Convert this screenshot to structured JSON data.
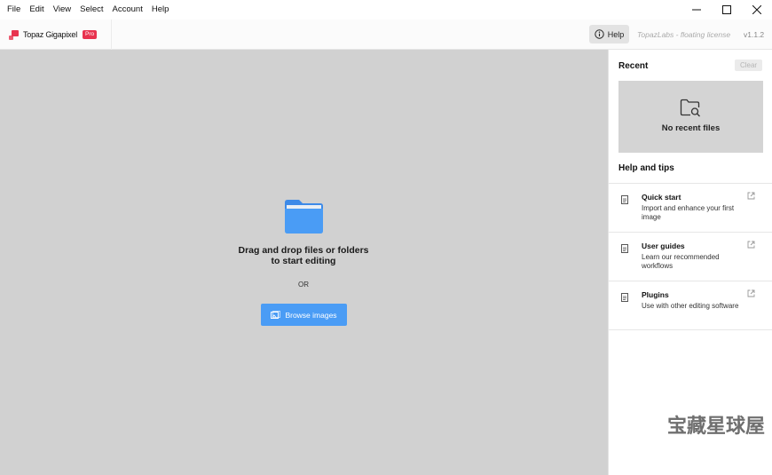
{
  "menu": [
    "File",
    "Edit",
    "View",
    "Select",
    "Account",
    "Help"
  ],
  "header": {
    "app_name": "Topaz Gigapixel",
    "badge": "Pro",
    "help_label": "Help",
    "license": "TopazLabs - floating license",
    "version": "v1.1.2"
  },
  "main": {
    "drop_line1": "Drag and drop files or folders",
    "drop_line2": "to start editing",
    "or": "OR",
    "browse_label": "Browse images"
  },
  "sidebar": {
    "recent_title": "Recent",
    "clear_label": "Clear",
    "no_recent": "No recent files",
    "help_title": "Help and tips",
    "tips": [
      {
        "title": "Quick start",
        "desc": "Import and enhance your first image"
      },
      {
        "title": "User guides",
        "desc": "Learn our recommended workflows"
      },
      {
        "title": "Plugins",
        "desc": "Use with other editing software"
      }
    ]
  },
  "watermark": "宝藏星球屋",
  "colors": {
    "accent": "#4a9cf5",
    "brand": "#e8334f",
    "dropzone": "#d1d1d1"
  }
}
